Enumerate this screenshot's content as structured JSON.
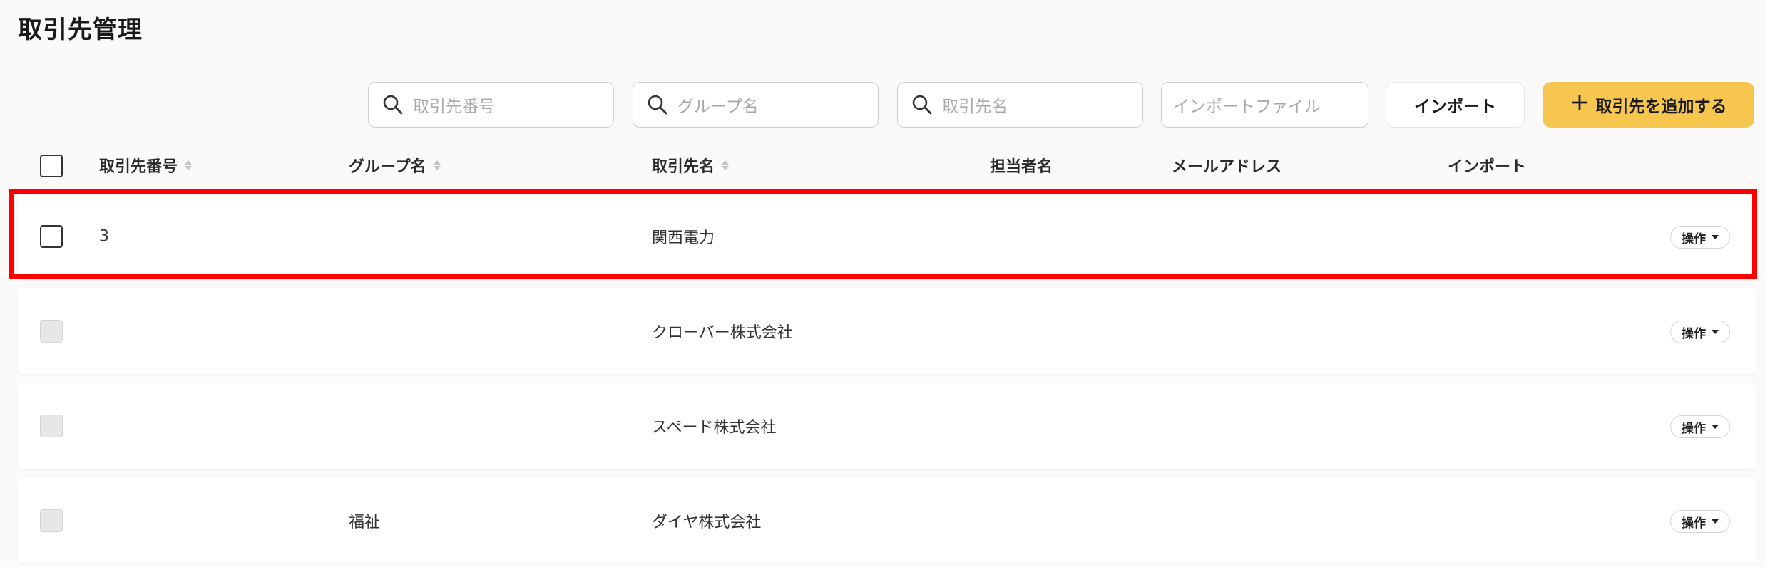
{
  "page": {
    "title": "取引先管理"
  },
  "toolbar": {
    "search_number_placeholder": "取引先番号",
    "search_group_placeholder": "グループ名",
    "search_name_placeholder": "取引先名",
    "import_file_placeholder": "インポートファイル",
    "import_label": "インポート",
    "add_label": "取引先を追加する"
  },
  "table": {
    "headers": {
      "number": "取引先番号",
      "group": "グループ名",
      "name": "取引先名",
      "person": "担当者名",
      "email": "メールアドレス",
      "import": "インポート"
    },
    "rows": [
      {
        "number": "3",
        "group": "",
        "name": "関西電力",
        "op": "操作",
        "checkbox_enabled": true
      },
      {
        "number": "",
        "group": "",
        "name": "クローバー株式会社",
        "op": "操作",
        "checkbox_enabled": false
      },
      {
        "number": "",
        "group": "",
        "name": "スペード株式会社",
        "op": "操作",
        "checkbox_enabled": false
      },
      {
        "number": "",
        "group": "福祉",
        "name": "ダイヤ株式会社",
        "op": "操作",
        "checkbox_enabled": false
      }
    ]
  },
  "colors": {
    "accent": "#f7c64f",
    "highlight": "#ff0000"
  }
}
